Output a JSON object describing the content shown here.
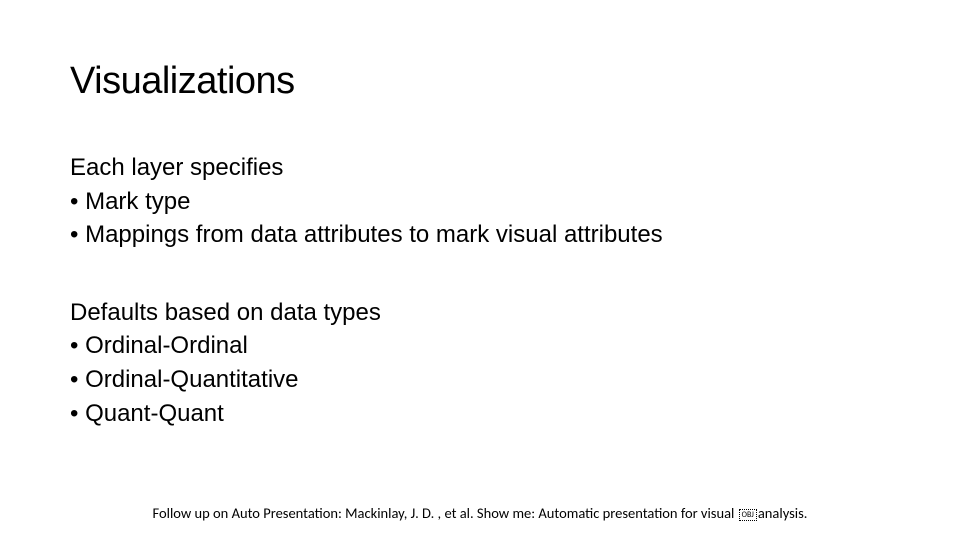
{
  "title": "Visualizations",
  "section1": {
    "heading": "Each layer specifies",
    "bullets": [
      "• Mark type",
      "• Mappings from data attributes to mark visual attributes"
    ]
  },
  "section2": {
    "heading": "Defaults based on data types",
    "bullets": [
      "• Ordinal-Ordinal",
      "• Ordinal-Quantitative",
      "• Quant-Quant"
    ]
  },
  "footer": {
    "part1": "Follow up on Auto Presentation: Mackinlay, J. D. , et al.  Show me: Automatic presentation for visual ",
    "obj": "OBJ",
    "part2": "analysis."
  }
}
